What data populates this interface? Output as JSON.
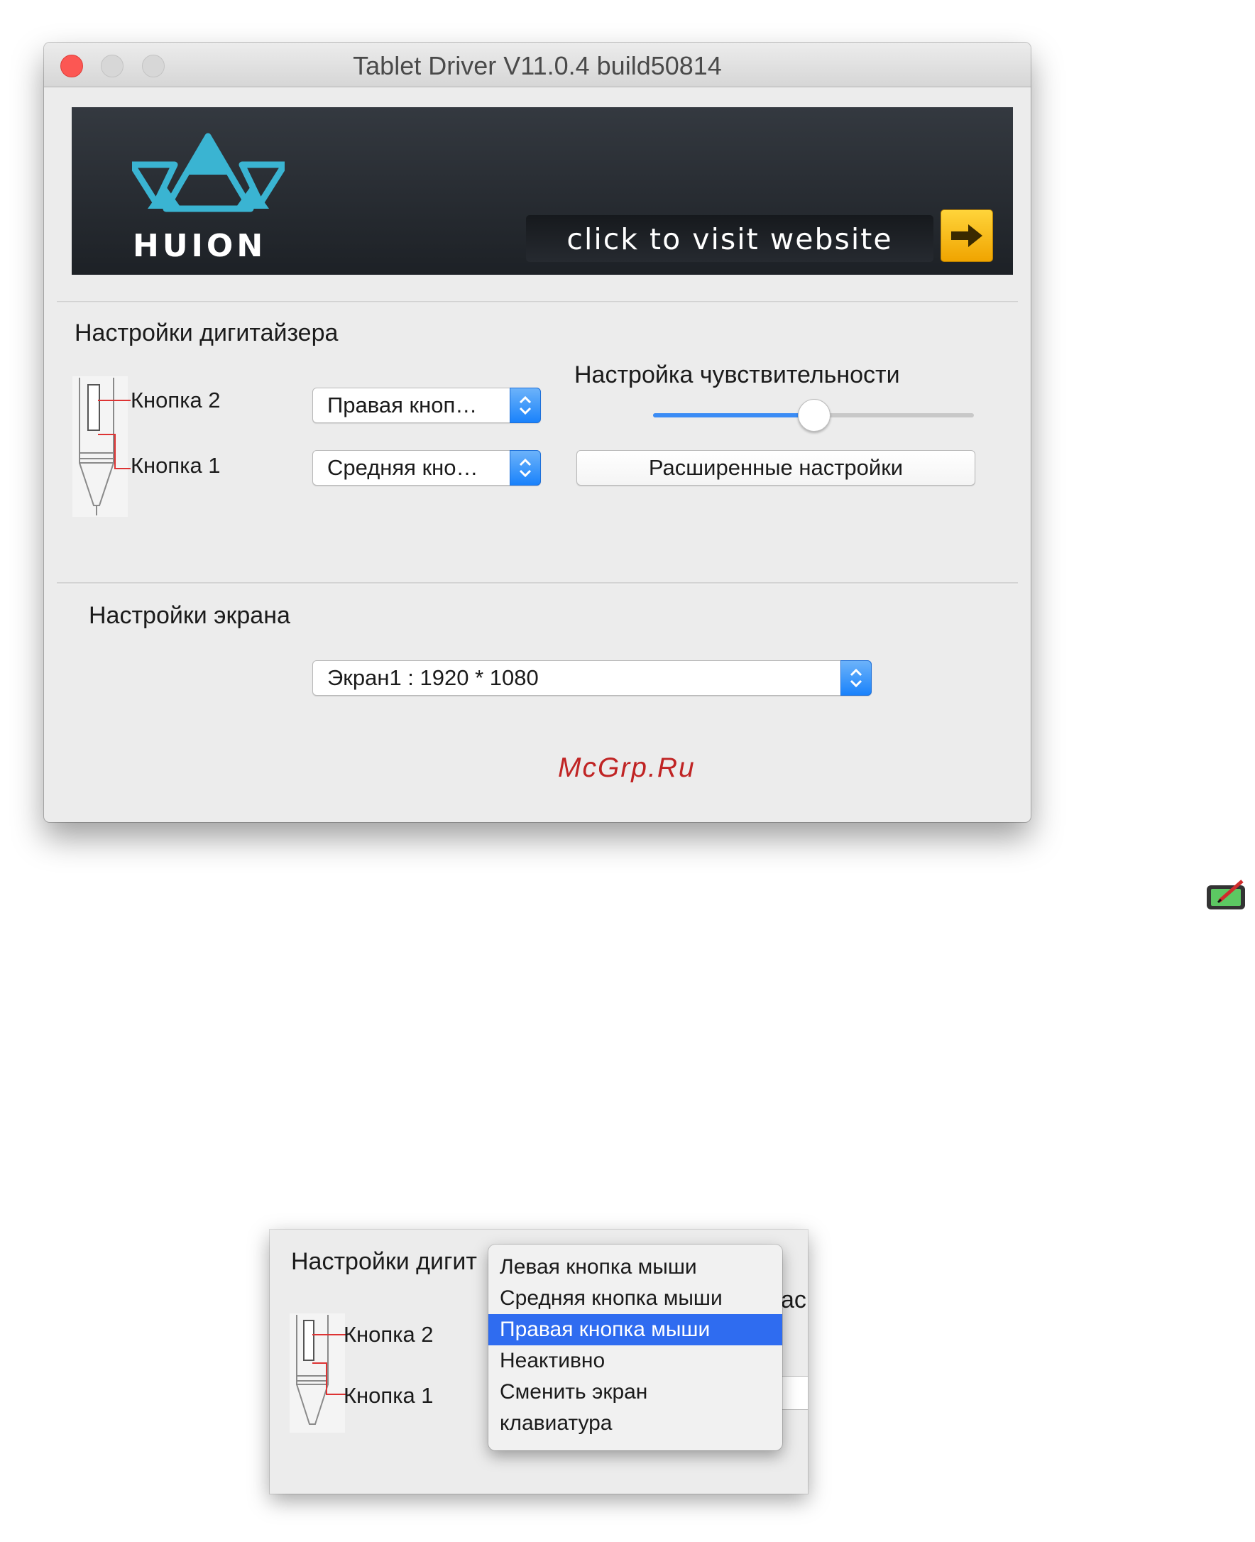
{
  "window": {
    "title": "Tablet Driver V11.0.4 build50814"
  },
  "banner": {
    "brand": "HUION",
    "visit_label": "click to visit website",
    "arrow_icon": "right-arrow-icon"
  },
  "digitizer": {
    "heading": "Настройки дигитайзера",
    "button2_label": "Кнопка 2",
    "button1_label": "Кнопка 1",
    "button2_value": "Правая кноп…",
    "button1_value": "Средняя кно…",
    "sensitivity_heading": "Настройка чувствительности",
    "sensitivity_level": 0.5,
    "advanced_label": "Расширенные настройки"
  },
  "screen": {
    "heading": "Настройки экрана",
    "value": "Экран1 : 1920 * 1080"
  },
  "watermark": "McGrp.Ru",
  "menu_shot": {
    "heading_partial": "Настройки дигит",
    "right_partial": "ас",
    "button2_label": "Кнопка 2",
    "button1_label": "Кнопка 1",
    "items": [
      "Левая кнопка мыши",
      "Средняя кнопка мыши",
      "Правая кнопка мыши",
      "Неактивно",
      "Сменить экран",
      "клавиатура"
    ],
    "selected_index": 2
  },
  "colors": {
    "accent": "#2f6cf0",
    "close": "#fc5753",
    "logo": "#3ab4d2",
    "arrow": "#f3b300",
    "watermark": "#c02424"
  }
}
